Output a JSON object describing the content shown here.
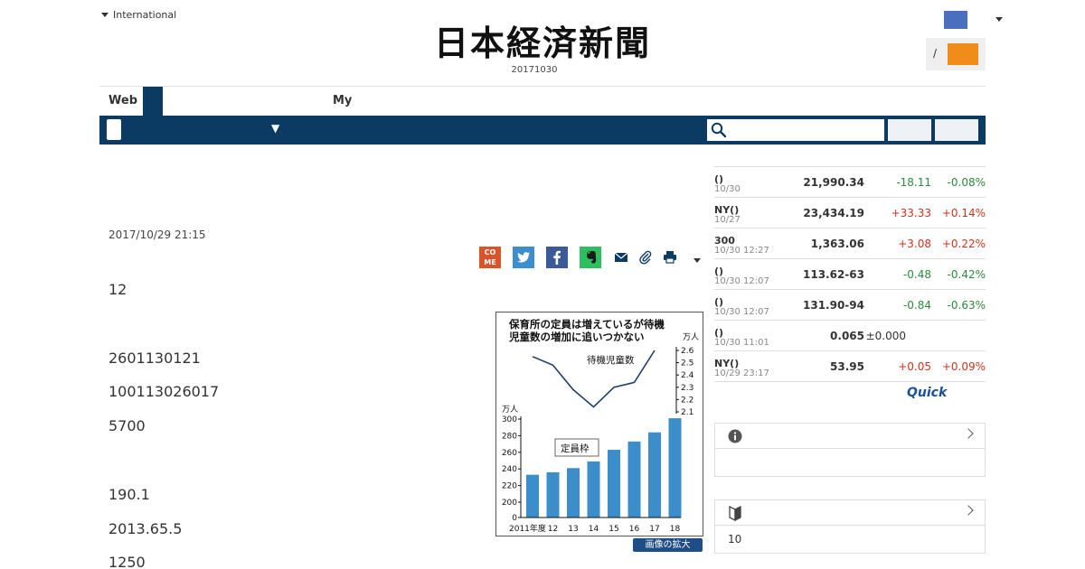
{
  "header": {
    "international_label": "International",
    "logo_text": "日本経済新聞",
    "edition_date": "20171030",
    "login_separator": "/"
  },
  "tabs": {
    "web_label": "Web",
    "my_label": "My"
  },
  "nav": {
    "dropdown_arrow": "▼",
    "search_placeholder": ""
  },
  "article": {
    "timestamp": "2017/10/29 21:15",
    "paragraphs": [
      "12",
      "2601130121",
      "100113026017",
      "5700",
      "190.1",
      "2013.65.5",
      "1250"
    ],
    "share_come_text": "CO\nME",
    "zoom_button_label": "画像の拡大"
  },
  "figure": {
    "title_line1": "保育所の定員は増えているが待機",
    "title_line2": "児童数の増加に追いつかない",
    "line_label": "待機児童数",
    "bar_label": "定員枠",
    "left_unit": "万人",
    "right_unit": "万人"
  },
  "chart_data": {
    "type": "bar",
    "title": "保育所の定員は増えているが待機児童数の増加に追いつかない",
    "categories": [
      "2011年度",
      "12",
      "13",
      "14",
      "15",
      "16",
      "17",
      "18"
    ],
    "series": [
      {
        "name": "定員枠",
        "axis": "left",
        "values": [
          233,
          236,
          241,
          249,
          263,
          273,
          284,
          301
        ]
      },
      {
        "name": "待機児童数",
        "axis": "right",
        "values": [
          2.55,
          2.48,
          2.28,
          2.14,
          2.3,
          2.34,
          2.6
        ]
      }
    ],
    "left_axis": {
      "label": "万人",
      "ticks": [
        0,
        200,
        220,
        240,
        260,
        280,
        300
      ],
      "ylim": [
        190,
        305
      ]
    },
    "right_axis": {
      "label": "万人",
      "ticks": [
        2.1,
        2.2,
        2.3,
        2.4,
        2.5,
        2.6
      ],
      "ylim": [
        2.05,
        2.65
      ]
    }
  },
  "market": {
    "rows": [
      {
        "name": "()",
        "time": "10/30",
        "value": "21,990.34",
        "change": "-18.11",
        "pct": "-0.08%",
        "dir": "down"
      },
      {
        "name": "NY()",
        "time": "10/27",
        "value": "23,434.19",
        "change": "+33.33",
        "pct": "+0.14%",
        "dir": "up"
      },
      {
        "name": "300",
        "time": "10/30 12:27",
        "value": "1,363.06",
        "change": "+3.08",
        "pct": "+0.22%",
        "dir": "up"
      },
      {
        "name": "()",
        "time": "10/30 12:07",
        "value": "113.62-63",
        "change": "-0.48",
        "pct": "-0.42%",
        "dir": "down"
      },
      {
        "name": "()",
        "time": "10/30 12:07",
        "value": "131.90-94",
        "change": "-0.84",
        "pct": "-0.63%",
        "dir": "down"
      },
      {
        "name": "()",
        "time": "10/30 11:01",
        "value": "0.065",
        "change": "±0.000",
        "pct": "",
        "dir": "flat"
      },
      {
        "name": "NY()",
        "time": "10/29 23:17",
        "value": "53.95",
        "change": "+0.05",
        "pct": "+0.09%",
        "dir": "up"
      }
    ],
    "provider_logo": "Quick"
  },
  "sidebar": {
    "box2_body": "10"
  },
  "colors": {
    "navy": "#0b3a62",
    "orange": "#f08c1a",
    "up": "#d0331b",
    "down": "#2c8a3a"
  }
}
